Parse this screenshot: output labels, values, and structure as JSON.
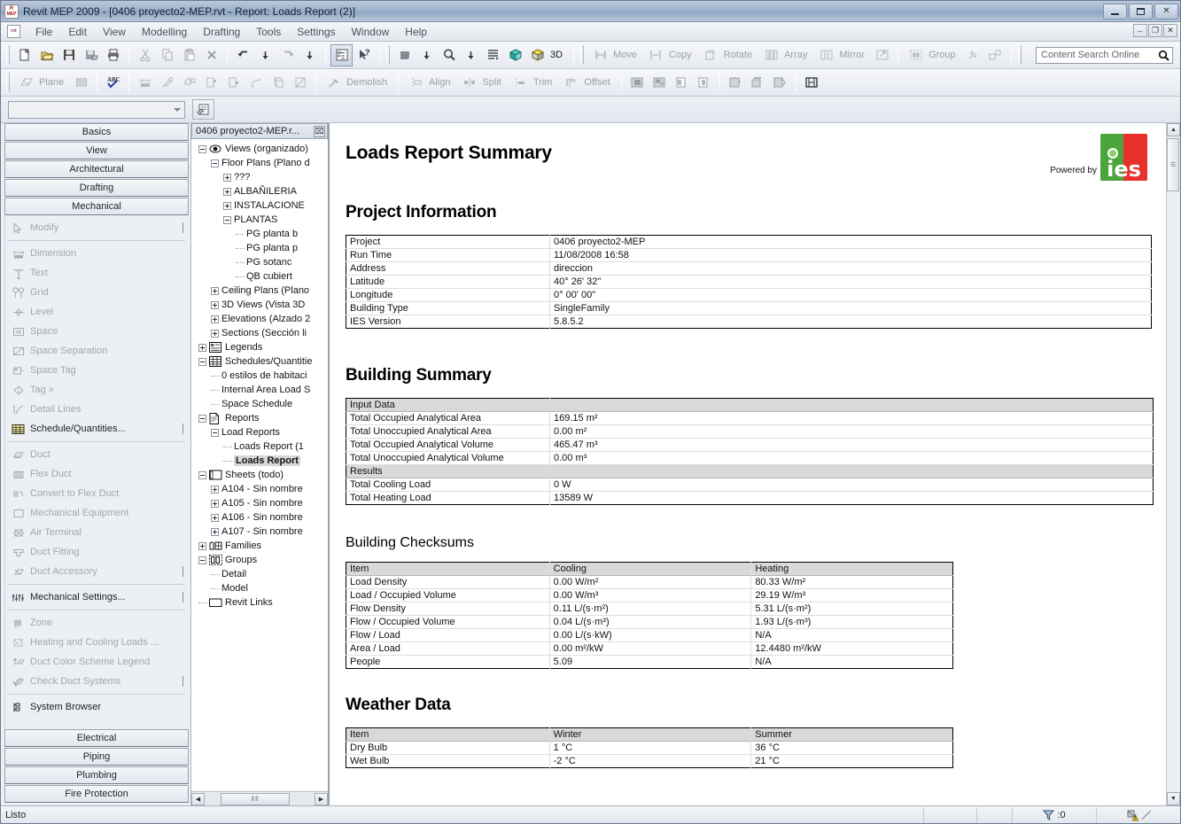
{
  "window": {
    "title": "Revit MEP 2009 - [0406 proyecto2-MEP.rvt - Report: Loads Report (2)]",
    "app_icon_label": "R",
    "app_icon_sub": "MEP",
    "minimize": "–",
    "maximize": "□",
    "close": "✕"
  },
  "menubar": {
    "doc_icon": "rvt",
    "items": [
      "File",
      "Edit",
      "View",
      "Modelling",
      "Drafting",
      "Tools",
      "Settings",
      "Window",
      "Help"
    ],
    "mdi_minimize": "–",
    "mdi_restore": "❐",
    "mdi_close": "✕"
  },
  "toolbar1": {
    "icons": [
      "new-file-icon",
      "open-folder-icon",
      "save-icon",
      "save-as-icon",
      "print-icon",
      "cut-icon",
      "copy-icon",
      "paste-icon",
      "delete-icon",
      "undo-icon",
      "undo-dropdown-icon",
      "redo-icon",
      "redo-dropdown-icon",
      "project-browser-icon",
      "context-help-icon",
      "shadows-icon",
      "shadows-dropdown-icon",
      "zoom-icon",
      "zoom-dropdown-icon",
      "thin-lines-icon",
      "render-icon",
      "default-3d-view-icon"
    ],
    "label_3d": "3D",
    "edit_tools": [
      {
        "label": "Move",
        "icon": "move-icon",
        "enabled": false
      },
      {
        "label": "Copy",
        "icon": "copy-tool-icon",
        "enabled": false
      },
      {
        "label": "Rotate",
        "icon": "rotate-icon",
        "enabled": false
      },
      {
        "label": "Array",
        "icon": "array-icon",
        "enabled": false
      },
      {
        "label": "Mirror",
        "icon": "mirror-icon",
        "enabled": false
      }
    ],
    "resize_icon": "resize-icon",
    "group_tools": [
      {
        "label": "Group",
        "icon": "group-icon",
        "enabled": false
      }
    ],
    "pin_icon": "pin-icon",
    "ungroup_icon": "ungroup-icon"
  },
  "search": {
    "placeholder": "Content Search Online",
    "value": "Content Search Online",
    "icon": "search-icon"
  },
  "toolbar2": {
    "items": [
      {
        "label": "Plane",
        "icon": "work-plane-icon",
        "enabled": false
      },
      {
        "label": "",
        "icon": "grid-pattern-icon",
        "enabled": false
      },
      {
        "label": "",
        "icon": "spell-check-icon",
        "enabled": true
      },
      {
        "label": "",
        "icon": "align-dimension-icon",
        "enabled": false
      },
      {
        "label": "",
        "icon": "eyedropper-icon",
        "enabled": false
      },
      {
        "label": "",
        "icon": "paint-icon",
        "enabled": false
      },
      {
        "label": "",
        "icon": "copy-element-icon",
        "enabled": false
      },
      {
        "label": "",
        "icon": "paste-element-icon",
        "enabled": false
      },
      {
        "label": "",
        "icon": "linework-icon",
        "enabled": false
      },
      {
        "label": "",
        "icon": "split-face-icon",
        "enabled": false
      },
      {
        "label": "",
        "icon": "cut-geometry-icon",
        "enabled": false
      },
      {
        "label": "Demolish",
        "icon": "demolish-icon",
        "enabled": false
      },
      {
        "label": "Align",
        "icon": "align-icon",
        "enabled": false
      },
      {
        "label": "Split",
        "icon": "split-icon",
        "enabled": false
      },
      {
        "label": "Trim",
        "icon": "trim-icon",
        "enabled": false
      },
      {
        "label": "Offset",
        "icon": "offset-icon",
        "enabled": false
      }
    ],
    "view_icons": [
      "crop-view-icon",
      "uncrop-view-icon",
      "hide-element-icon",
      "reveal-hidden-icon",
      "temporary-hide-icon",
      "reset-temp-hide-icon",
      "hide-category-icon",
      "sheet-scale-icon"
    ]
  },
  "typebar": {
    "combo_value": "",
    "properties_icon": "element-properties-icon"
  },
  "designbar": {
    "tabs_top": [
      "Basics",
      "View",
      "Architectural",
      "Drafting",
      "Mechanical"
    ],
    "tabs_bottom": [
      "Electrical",
      "Piping",
      "Plumbing",
      "Fire Protection"
    ],
    "groups": [
      {
        "items": [
          {
            "label": "Modify",
            "icon": "arrow-cursor-icon",
            "enabled": false,
            "tick": true
          }
        ]
      },
      {
        "items": [
          {
            "label": "Dimension",
            "icon": "dimension-icon",
            "enabled": false,
            "tick": false
          },
          {
            "label": "Text",
            "icon": "text-icon",
            "enabled": false,
            "tick": false
          },
          {
            "label": "Grid",
            "icon": "grid-icon",
            "enabled": false,
            "tick": false
          },
          {
            "label": "Level",
            "icon": "level-icon",
            "enabled": false,
            "tick": false
          },
          {
            "label": "Space",
            "icon": "space-icon",
            "enabled": false,
            "tick": false
          },
          {
            "label": "Space Separation",
            "icon": "space-separation-icon",
            "enabled": false,
            "tick": false
          },
          {
            "label": "Space Tag",
            "icon": "space-tag-icon",
            "enabled": false,
            "tick": false
          },
          {
            "label": "Tag »",
            "icon": "tag-icon",
            "enabled": false,
            "tick": false
          },
          {
            "label": "Detail Lines",
            "icon": "detail-lines-icon",
            "enabled": false,
            "tick": false
          },
          {
            "label": "Schedule/Quantities...",
            "icon": "schedule-icon",
            "enabled": true,
            "tick": true
          }
        ]
      },
      {
        "items": [
          {
            "label": "Duct",
            "icon": "duct-icon",
            "enabled": false,
            "tick": false
          },
          {
            "label": "Flex Duct",
            "icon": "flex-duct-icon",
            "enabled": false,
            "tick": false
          },
          {
            "label": "Convert to Flex Duct",
            "icon": "convert-flex-duct-icon",
            "enabled": false,
            "tick": false
          },
          {
            "label": "Mechanical Equipment",
            "icon": "mechanical-equipment-icon",
            "enabled": false,
            "tick": false
          },
          {
            "label": "Air Terminal",
            "icon": "air-terminal-icon",
            "enabled": false,
            "tick": false
          },
          {
            "label": "Duct Fitting",
            "icon": "duct-fitting-icon",
            "enabled": false,
            "tick": false
          },
          {
            "label": "Duct Accessory",
            "icon": "duct-accessory-icon",
            "enabled": false,
            "tick": true
          }
        ]
      },
      {
        "items": [
          {
            "label": "Mechanical Settings...",
            "icon": "mechanical-settings-icon",
            "enabled": true,
            "tick": true
          }
        ]
      },
      {
        "items": [
          {
            "label": "Zone",
            "icon": "zone-icon",
            "enabled": false,
            "tick": false
          },
          {
            "label": "Heating and Cooling Loads ...",
            "icon": "heating-cooling-loads-icon",
            "enabled": false,
            "tick": false
          },
          {
            "label": "Duct Color Scheme Legend",
            "icon": "duct-color-scheme-icon",
            "enabled": false,
            "tick": false
          },
          {
            "label": "Check Duct Systems",
            "icon": "check-duct-systems-icon",
            "enabled": false,
            "tick": true
          }
        ]
      },
      {
        "items": [
          {
            "label": "System Browser",
            "icon": "system-browser-icon",
            "enabled": true,
            "tick": false
          }
        ]
      }
    ]
  },
  "browser": {
    "title": "0406 proyecto2-MEP.r...",
    "close_glyph": "⌧",
    "tree": [
      {
        "depth": 0,
        "box": "minus",
        "icon": "eye-icon",
        "label": "Views (organizado)",
        "selected": false
      },
      {
        "depth": 1,
        "box": "minus",
        "icon": "",
        "label": "Floor Plans (Plano d",
        "selected": false
      },
      {
        "depth": 2,
        "box": "plus",
        "icon": "",
        "label": "???",
        "selected": false
      },
      {
        "depth": 2,
        "box": "plus",
        "icon": "",
        "label": "ALBAÑILERIA",
        "selected": false
      },
      {
        "depth": 2,
        "box": "plus",
        "icon": "",
        "label": "INSTALACIONE",
        "selected": false
      },
      {
        "depth": 2,
        "box": "minus",
        "icon": "",
        "label": "PLANTAS",
        "selected": false
      },
      {
        "depth": 3,
        "box": "none",
        "icon": "",
        "label": "PG planta b",
        "selected": false
      },
      {
        "depth": 3,
        "box": "none",
        "icon": "",
        "label": "PG planta p",
        "selected": false
      },
      {
        "depth": 3,
        "box": "none",
        "icon": "",
        "label": "PG sotanc",
        "selected": false
      },
      {
        "depth": 3,
        "box": "none",
        "icon": "",
        "label": "QB cubiert",
        "selected": false
      },
      {
        "depth": 1,
        "box": "plus",
        "icon": "",
        "label": "Ceiling Plans (Plano",
        "selected": false
      },
      {
        "depth": 1,
        "box": "plus",
        "icon": "",
        "label": "3D Views (Vista 3D",
        "selected": false
      },
      {
        "depth": 1,
        "box": "plus",
        "icon": "",
        "label": "Elevations (Alzado 2",
        "selected": false
      },
      {
        "depth": 1,
        "box": "plus",
        "icon": "",
        "label": "Sections (Sección li",
        "selected": false
      },
      {
        "depth": 0,
        "box": "plus",
        "icon": "legend-icon",
        "label": "Legends",
        "selected": false
      },
      {
        "depth": 0,
        "box": "minus",
        "icon": "schedule-tree-icon",
        "label": "Schedules/Quantitie",
        "selected": false
      },
      {
        "depth": 1,
        "box": "none",
        "icon": "",
        "label": "0 estilos de habitaci",
        "selected": false
      },
      {
        "depth": 1,
        "box": "none",
        "icon": "",
        "label": "Internal Area Load S",
        "selected": false
      },
      {
        "depth": 1,
        "box": "none",
        "icon": "",
        "label": "Space Schedule",
        "selected": false
      },
      {
        "depth": 0,
        "box": "minus",
        "icon": "report-icon",
        "label": "Reports",
        "selected": false
      },
      {
        "depth": 1,
        "box": "minus",
        "icon": "",
        "label": "Load Reports",
        "selected": false
      },
      {
        "depth": 2,
        "box": "none",
        "icon": "",
        "label": "Loads Report (1",
        "selected": false
      },
      {
        "depth": 2,
        "box": "none",
        "icon": "",
        "label": "Loads Report",
        "selected": true
      },
      {
        "depth": 0,
        "box": "minus",
        "icon": "sheet-icon",
        "label": "Sheets (todo)",
        "selected": false
      },
      {
        "depth": 1,
        "box": "plus",
        "icon": "",
        "label": "A104 - Sin nombre",
        "selected": false
      },
      {
        "depth": 1,
        "box": "plus",
        "icon": "",
        "label": "A105 - Sin nombre",
        "selected": false
      },
      {
        "depth": 1,
        "box": "plus",
        "icon": "",
        "label": "A106 - Sin nombre",
        "selected": false
      },
      {
        "depth": 1,
        "box": "plus",
        "icon": "",
        "label": "A107 - Sin nombre",
        "selected": false
      },
      {
        "depth": 0,
        "box": "plus",
        "icon": "families-icon",
        "label": "Families",
        "selected": false
      },
      {
        "depth": 0,
        "box": "minus",
        "icon": "groups-icon",
        "label": "Groups",
        "selected": false
      },
      {
        "depth": 1,
        "box": "none",
        "icon": "",
        "label": "Detail",
        "selected": false
      },
      {
        "depth": 1,
        "box": "none",
        "icon": "",
        "label": "Model",
        "selected": false
      },
      {
        "depth": 0,
        "box": "none",
        "icon": "revit-links-icon",
        "label": "Revit Links",
        "selected": false
      }
    ],
    "hscroll": {
      "left_arrow": "◀",
      "right_arrow": "▶",
      "thumb_glyph": "‖‖"
    }
  },
  "report": {
    "title": "Loads Report Summary",
    "powered_by": "Powered by",
    "logo_text": "ies",
    "project_information": {
      "heading": "Project Information",
      "rows": [
        {
          "label": "Project",
          "value": "0406 proyecto2-MEP"
        },
        {
          "label": "Run Time",
          "value": "11/08/2008 16:58"
        },
        {
          "label": "Address",
          "value": "direccion"
        },
        {
          "label": "Latitude",
          "value": "40° 26' 32\""
        },
        {
          "label": "Longitude",
          "value": "0° 00' 00\""
        },
        {
          "label": "Building Type",
          "value": "SingleFamily"
        },
        {
          "label": "IES Version",
          "value": "5.8.5.2"
        }
      ]
    },
    "building_summary": {
      "heading": "Building Summary",
      "rows": [
        {
          "label": "Input Data",
          "value": "",
          "header": true
        },
        {
          "label": "Total Occupied Analytical Area",
          "value": "169.15 m²",
          "header": false
        },
        {
          "label": "Total Unoccupied Analytical Area",
          "value": "0.00 m²",
          "header": false
        },
        {
          "label": "Total Occupied Analytical Volume",
          "value": "465.47 m³",
          "header": false
        },
        {
          "label": "Total Unoccupied Analytical Volume",
          "value": "0.00 m³",
          "header": false
        },
        {
          "label": "Results",
          "value": "",
          "header": true
        },
        {
          "label": "Total Cooling Load",
          "value": "0 W",
          "header": false
        },
        {
          "label": "Total Heating Load",
          "value": "13589 W",
          "header": false
        }
      ]
    },
    "building_checksums": {
      "heading": "Building Checksums",
      "columns": [
        "Item",
        "Cooling",
        "Heating"
      ],
      "rows": [
        [
          "Load Density",
          "0.00 W/m²",
          "80.33 W/m²"
        ],
        [
          "Load / Occupied Volume",
          "0.00 W/m³",
          "29.19 W/m³"
        ],
        [
          "Flow Density",
          "0.11 L/(s·m²)",
          "5.31 L/(s·m²)"
        ],
        [
          "Flow / Occupied Volume",
          "0.04 L/(s·m³)",
          "1.93 L/(s·m³)"
        ],
        [
          "Flow / Load",
          "0.00 L/(s·kW)",
          "N/A"
        ],
        [
          "Area / Load",
          "0.00 m²/kW",
          "12.4480 m²/kW"
        ],
        [
          "People",
          "5.09",
          "N/A"
        ]
      ]
    },
    "weather_data": {
      "heading": "Weather Data",
      "columns": [
        "Item",
        "Winter",
        "Summer"
      ],
      "rows": [
        [
          "Dry Bulb",
          "1 °C",
          "36 °C"
        ],
        [
          "Wet Bulb",
          "-2 °C",
          "21 °C"
        ]
      ]
    }
  },
  "statusbar": {
    "message": "Listo",
    "filter_count": ":0",
    "filter_icon": "filter-icon",
    "warning_icon": "warning-icon"
  }
}
